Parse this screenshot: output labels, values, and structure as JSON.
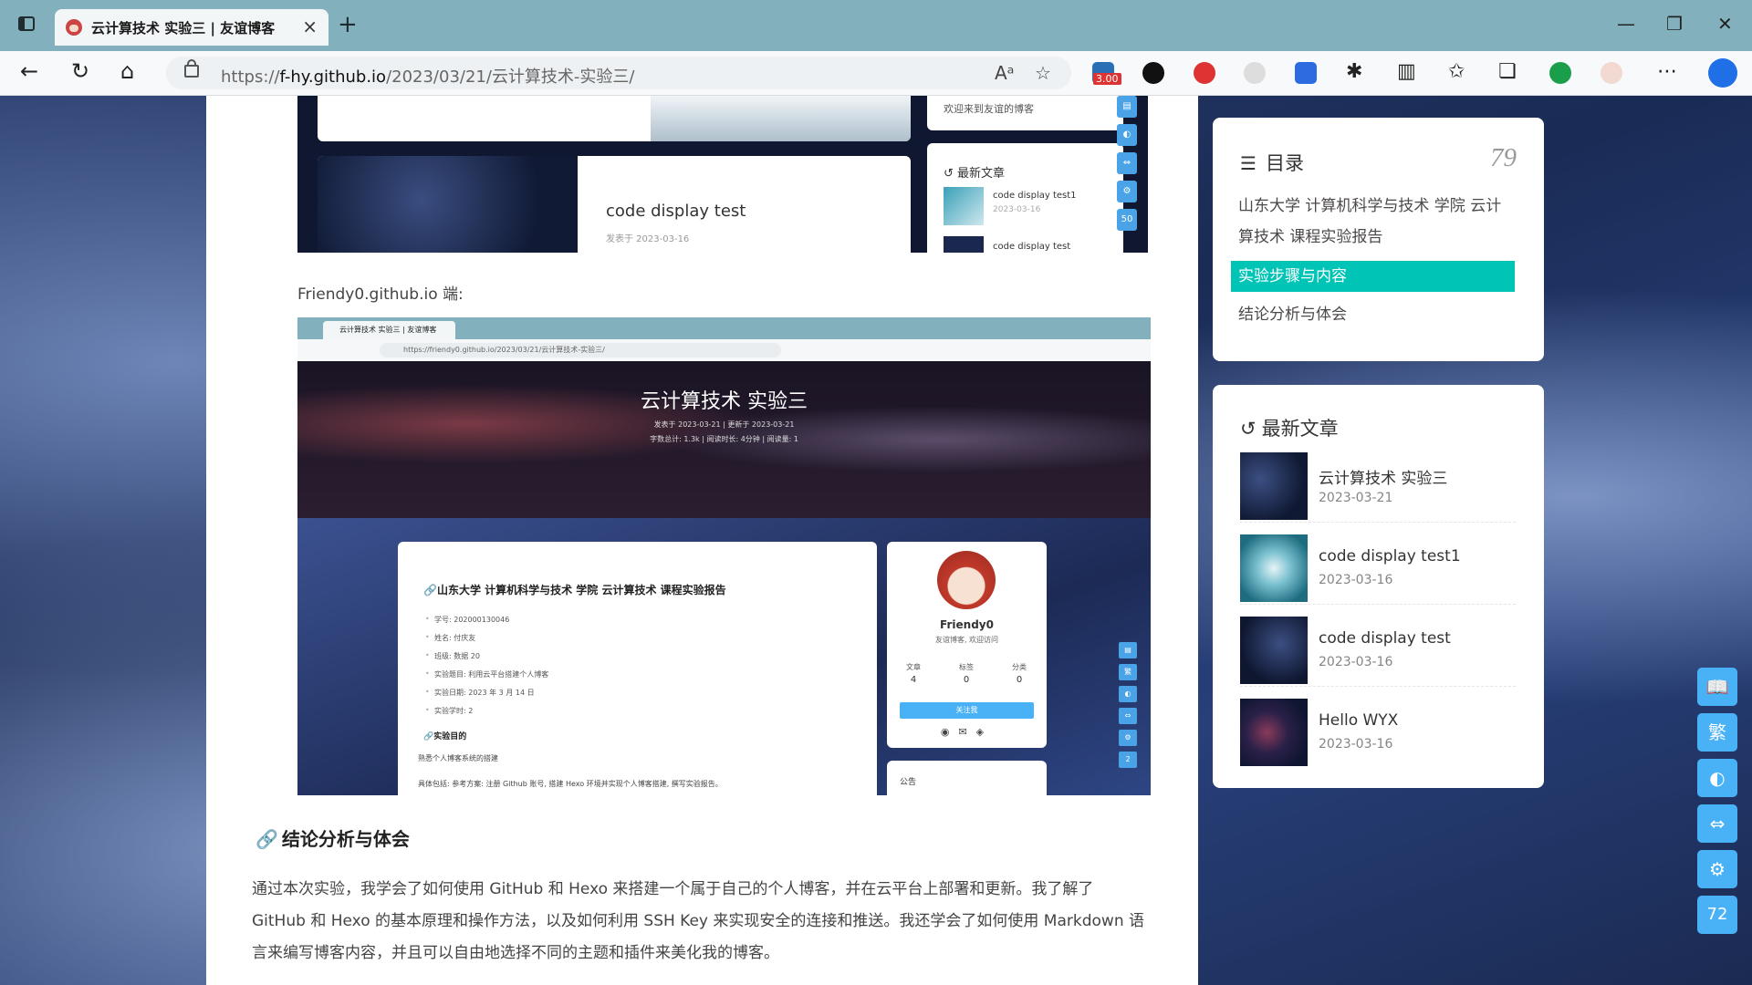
{
  "browser": {
    "tab_title": "云计算技术 实验三 | 友谊博客",
    "tab_close": "×",
    "new_tab": "+",
    "url_prefix": "https://",
    "url_host": "f-hy.github.io",
    "url_path": "/2023/03/21/云计算技术-实验三/",
    "ext_badge": "3.00",
    "window": {
      "minimize": "—",
      "maximize": "❐",
      "close": "✕"
    }
  },
  "article": {
    "shot1": {
      "welcome": "欢迎来到友谊的博客",
      "latest_title": "最新文章",
      "post_title": "code display test",
      "post_meta": "发表于 2023-03-16",
      "items": [
        {
          "title": "code display test1",
          "date": "2023-03-16"
        },
        {
          "title": "code display test"
        }
      ],
      "btn_num": "50"
    },
    "caption": "Friendy0.github.io 端:",
    "shot2": {
      "tab": "云计算技术 实验三 | 友谊博客",
      "url": "https://friendy0.github.io/2023/03/21/云计算技术-实验三/",
      "title": "云计算技术 实验三",
      "meta1": "发表于 2023-03-21 | 更新于 2023-03-21",
      "meta2": "字数总计: 1.3k | 阅读时长: 4分钟 | 阅读量: 1",
      "heading": "山东大学 计算机科学与技术 学院 云计算技术 课程实验报告",
      "list": [
        "学号: 202000130046",
        "姓名: 付庆友",
        "班级: 数据 20",
        "实验题目: 利用云平台搭建个人博客",
        "实验日期: 2023 年 3 月 14 日",
        "实验学时: 2"
      ],
      "purpose_h": "实验目的",
      "purpose_p1": "熟悉个人博客系统的搭建",
      "purpose_p2": "具体包括: 参考方案: 注册 Github 账号, 搭建 Hexo 环境并实现个人博客搭建, 撰写实验报告。",
      "profile": {
        "name": "Friendy0",
        "desc": "友谊博客, 欢迎访问",
        "stats": [
          {
            "label": "文章",
            "value": "4"
          },
          {
            "label": "标签",
            "value": "0"
          },
          {
            "label": "分类",
            "value": "0"
          }
        ],
        "follow": "关注我"
      },
      "notice": "公告",
      "btn_num": "2"
    },
    "section_title": "结论分析与体会",
    "paragraph": "通过本次实验，我学会了如何使用 GitHub 和 Hexo 来搭建一个属于自己的个人博客，并在云平台上部署和更新。我了解了 GitHub 和 Hexo 的基本原理和操作方法，以及如何利用 SSH Key 来实现安全的连接和推送。我还学会了如何使用 Markdown 语言来编写博客内容，并且可以自由地选择不同的主题和插件来美化我的博客。"
  },
  "toc": {
    "title": "目录",
    "percent": "79",
    "items": [
      {
        "label": "山东大学 计算机科学与技术 学院 云计算技术 课程实验报告"
      },
      {
        "label": "实验步骤与内容"
      },
      {
        "label": "结论分析与体会"
      }
    ]
  },
  "recent": {
    "title": "最新文章",
    "posts": [
      {
        "title": "云计算技术 实验三",
        "date": "2023-03-21"
      },
      {
        "title": "code display test1",
        "date": "2023-03-16"
      },
      {
        "title": "code display test",
        "date": "2023-03-16"
      },
      {
        "title": "Hello WYX",
        "date": "2023-03-16"
      }
    ]
  },
  "float_buttons": {
    "read": "📖",
    "trad": "繁",
    "theme": "◐",
    "width": "⇔",
    "settings": "⚙",
    "progress": "72"
  },
  "colors": {
    "accent": "#49b1f5",
    "toc_active": "#00c4b6",
    "link_icon": "#f47466"
  }
}
